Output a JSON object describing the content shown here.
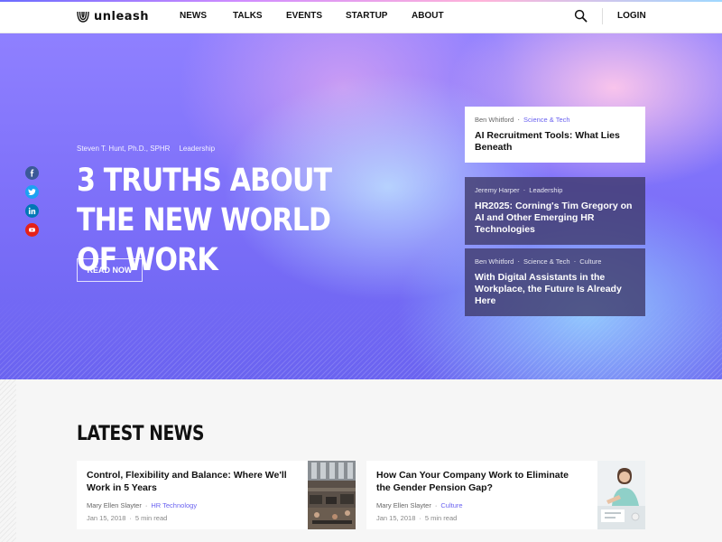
{
  "header": {
    "logo_text": "unleash",
    "nav": [
      {
        "label": "NEWS"
      },
      {
        "label": "TALKS"
      },
      {
        "label": "EVENTS"
      },
      {
        "label": "STARTUP"
      },
      {
        "label": "ABOUT"
      }
    ],
    "search_icon": "search-icon",
    "login_label": "LOGIN"
  },
  "hero": {
    "author": "Steven T. Hunt, Ph.D., SPHR",
    "category": "Leadership",
    "title": "3 TRUTHS ABOUT THE NEW WORLD OF WORK",
    "cta": "READ NOW",
    "social": [
      {
        "icon": "facebook-icon",
        "color": "#3b5998",
        "glyph": "f"
      },
      {
        "icon": "twitter-icon",
        "color": "#1da1f2",
        "glyph": "t"
      },
      {
        "icon": "linkedin-icon",
        "color": "#0077b5",
        "glyph": "in"
      },
      {
        "icon": "youtube-icon",
        "color": "#e62117",
        "glyph": "▶"
      }
    ]
  },
  "featured": [
    {
      "author": "Ben Whitford",
      "categories": [
        "Science & Tech"
      ],
      "title": "AI Recruitment Tools: What Lies Beneath",
      "style": "white"
    },
    {
      "author": "Jeremy Harper",
      "categories": [
        "Leadership"
      ],
      "title": "HR2025: Corning's Tim Gregory on AI and Other Emerging HR Technologies",
      "style": "dark"
    },
    {
      "author": "Ben Whitford",
      "categories": [
        "Science & Tech",
        "Culture"
      ],
      "title": "With Digital Assistants in the Workplace, the Future Is Already Here",
      "style": "dark"
    }
  ],
  "latest": {
    "heading": "LATEST NEWS",
    "items": [
      {
        "title": "Control, Flexibility and Balance: Where We'll Work in 5 Years",
        "author": "Mary Ellen Slayter",
        "category": "HR Technology",
        "date": "Jan 15, 2018",
        "read_time": "5 min read"
      },
      {
        "title": "How Can Your Company Work to Eliminate the Gender Pension Gap?",
        "author": "Mary Ellen Slayter",
        "category": "Culture",
        "date": "Jan 15, 2018",
        "read_time": "5 min read"
      }
    ]
  },
  "colors": {
    "accent": "#6b63f0",
    "hero_base": "#7b6ef8"
  }
}
